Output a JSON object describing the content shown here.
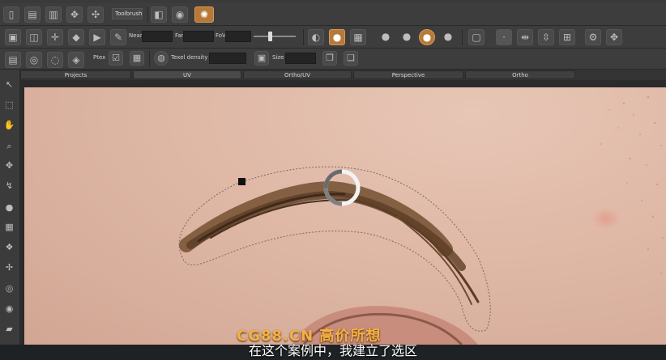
{
  "toolbar_row1": {
    "toolbrush_label": "Toolbrush"
  },
  "toolbar_row2": {
    "near_label": "Near",
    "far_label": "Far",
    "fov_label": "FoV",
    "near_value": "",
    "far_value": "",
    "fov_value": ""
  },
  "toolbar_row3": {
    "ptex_label": "Ptex",
    "texel_density_label": "Texel density :",
    "texel_density_value": "",
    "size_label": "Size :",
    "size_value": ""
  },
  "tabs": [
    "Projects",
    "UV",
    "Ortho/UV",
    "Perspective",
    "Ortho"
  ],
  "active_tab_index": 1,
  "overlay": {
    "watermark": "CG88.CN 高价所想",
    "subtitle": "在这个案例中，我建立了选区"
  },
  "colors": {
    "accent": "#b57a3a",
    "watermark": "#f6b043"
  }
}
